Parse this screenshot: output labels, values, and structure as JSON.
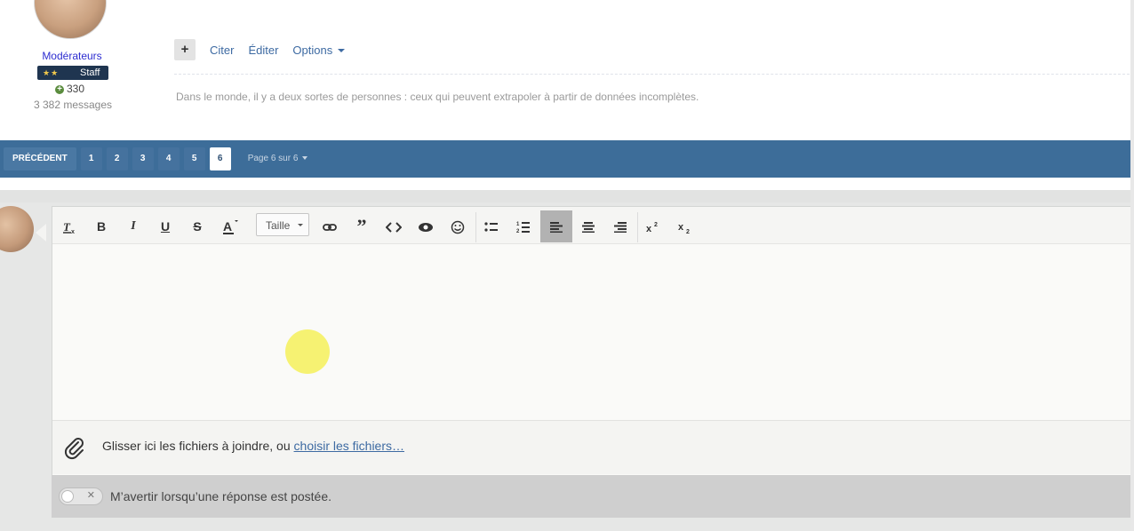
{
  "author": {
    "group": "Modérateurs",
    "badge": "Staff",
    "reputation": "330",
    "messages": "3 382 messages"
  },
  "post": {
    "actions": [
      "Citer",
      "Éditer",
      "Options"
    ],
    "signature": "Dans le monde, il y a deux sortes de personnes : ceux qui peuvent extrapoler à partir de données incomplètes."
  },
  "pagination": {
    "prev": "PRÉCÉDENT",
    "pages": [
      "1",
      "2",
      "3",
      "4",
      "5",
      "6"
    ],
    "active": "6",
    "label": "Page 6 sur 6"
  },
  "editor": {
    "size_label": "Taille",
    "toolbar_icons": [
      "clear-format-icon",
      "bold-icon",
      "italic-icon",
      "underline-icon",
      "strikethrough-icon",
      "text-color-icon",
      "size-select",
      "link-icon",
      "quote-icon",
      "code-icon",
      "spoiler-icon",
      "emoji-icon",
      "bullet-list-icon",
      "numbered-list-icon",
      "align-left-icon",
      "align-center-icon",
      "align-right-icon",
      "superscript-icon",
      "subscript-icon"
    ],
    "active_tool": "align-left-icon"
  },
  "attachments": {
    "text": "Glisser ici les fichiers à joindre, ou ",
    "link": "choisir les fichiers…"
  },
  "notify": {
    "label": "M’avertir lorsqu’une réponse est postée."
  },
  "colors": {
    "pagebar": "#3d6d99",
    "link": "#3d6aa2",
    "staff_badge": "#1f3550",
    "cursor_highlight": "#f6f16a"
  }
}
